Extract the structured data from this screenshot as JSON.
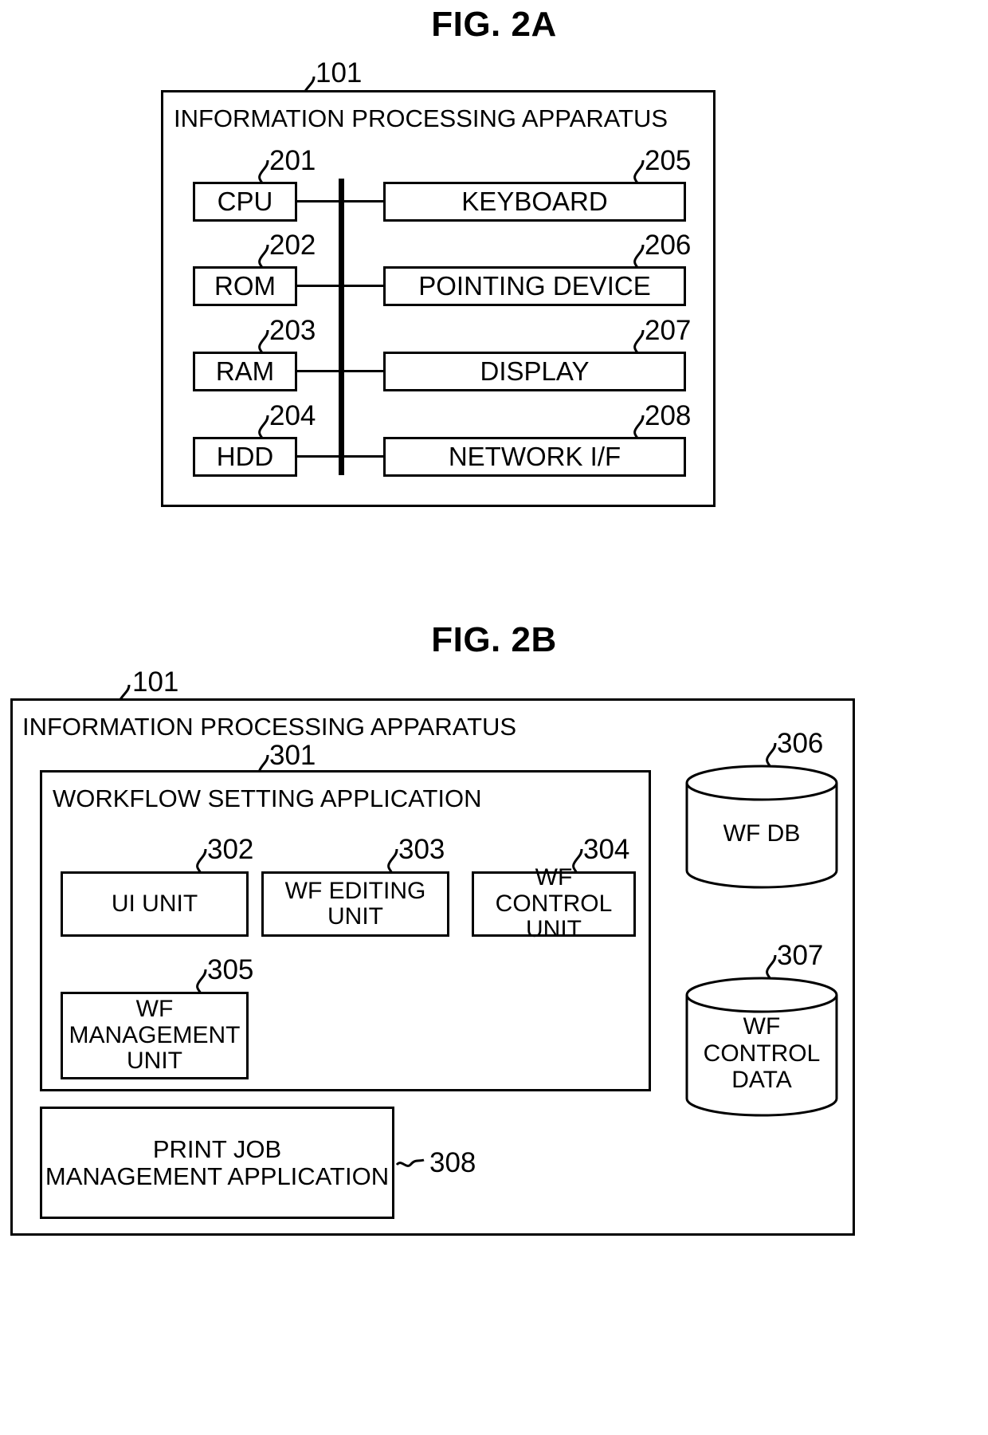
{
  "figures": {
    "fig2a": {
      "title": "FIG. 2A",
      "apparatus_ref": "101",
      "apparatus_label": "INFORMATION PROCESSING APPARATUS",
      "left_blocks": [
        {
          "ref": "201",
          "label": "CPU"
        },
        {
          "ref": "202",
          "label": "ROM"
        },
        {
          "ref": "203",
          "label": "RAM"
        },
        {
          "ref": "204",
          "label": "HDD"
        }
      ],
      "right_blocks": [
        {
          "ref": "205",
          "label": "KEYBOARD"
        },
        {
          "ref": "206",
          "label": "POINTING DEVICE"
        },
        {
          "ref": "207",
          "label": "DISPLAY"
        },
        {
          "ref": "208",
          "label": "NETWORK I/F"
        }
      ]
    },
    "fig2b": {
      "title": "FIG. 2B",
      "apparatus_ref": "101",
      "apparatus_label": "INFORMATION PROCESSING APPARATUS",
      "application_ref": "301",
      "application_label": "WORKFLOW SETTING APPLICATION",
      "units": [
        {
          "ref": "302",
          "label": "UI UNIT"
        },
        {
          "ref": "303",
          "label": "WF EDITING\nUNIT"
        },
        {
          "ref": "304",
          "label": "WF CONTROL\nUNIT"
        },
        {
          "ref": "305",
          "label": "WF\nMANAGEMENT\nUNIT"
        }
      ],
      "print_job": {
        "ref": "308",
        "label": "PRINT JOB\nMANAGEMENT APPLICATION"
      },
      "databases": [
        {
          "ref": "306",
          "label": "WF DB"
        },
        {
          "ref": "307",
          "label": "WF\nCONTROL\nDATA"
        }
      ]
    }
  },
  "colors": {
    "line": "#000000",
    "background": "#ffffff"
  }
}
